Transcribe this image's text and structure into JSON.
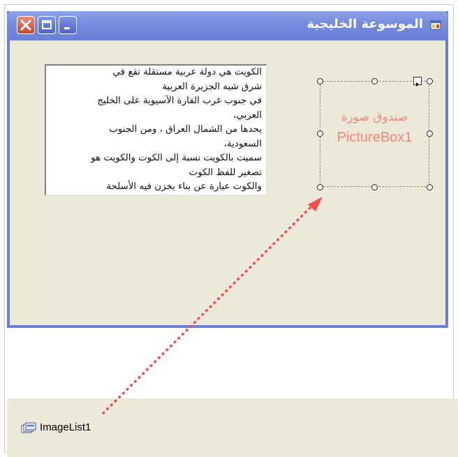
{
  "window": {
    "title": "الموسوعة الخليجية"
  },
  "textbox": {
    "lines": [
      "الكويت هي دولة عربية مستقلة تقع في",
      "شرق شبه الجزيرة العربية",
      "في جنوب غرب القارة الآسيوية على الخليج",
      "العربي،",
      "يحدها من الشمال العراق ، ومن الجنوب",
      "السعودية،",
      "سميت بالكويت نسبة إلى الكوت والكويت هو",
      "تصغير للفظ الكوت",
      "والكوت عبارة عن بناء يخزن فيه الأسلحة"
    ]
  },
  "picturebox": {
    "label_ar": "صندوق صورة",
    "label_en": "PictureBox1"
  },
  "tray": {
    "component_label": "ImageList1"
  },
  "colors": {
    "titlebar": "#7389dc",
    "form_bg": "#ece9d8",
    "annotation": "#f0887a",
    "arrow": "#f05050"
  },
  "icons": {
    "close": "close-icon",
    "maximize": "maximize-icon",
    "minimize": "minimize-icon",
    "form": "form-icon",
    "imagelist": "imagelist-icon",
    "smart_tag": "smart-tag-arrow-icon"
  }
}
